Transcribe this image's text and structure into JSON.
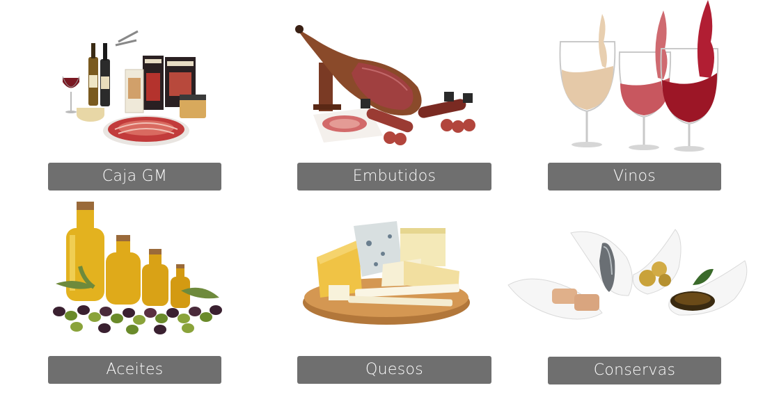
{
  "categories": [
    {
      "label": "Caja GM",
      "image": "gift-box-products-image"
    },
    {
      "label": "Embutidos",
      "image": "ham-and-cured-meats-image"
    },
    {
      "label": "Vinos",
      "image": "wine-glasses-image"
    },
    {
      "label": "Aceites",
      "image": "olive-oil-bottles-image"
    },
    {
      "label": "Quesos",
      "image": "cheese-board-image"
    },
    {
      "label": "Conservas",
      "image": "canned-seafood-spoons-image"
    }
  ],
  "colors": {
    "button_bg": "#6f6f6f",
    "button_text": "#ffffff",
    "background": "#ffffff"
  }
}
